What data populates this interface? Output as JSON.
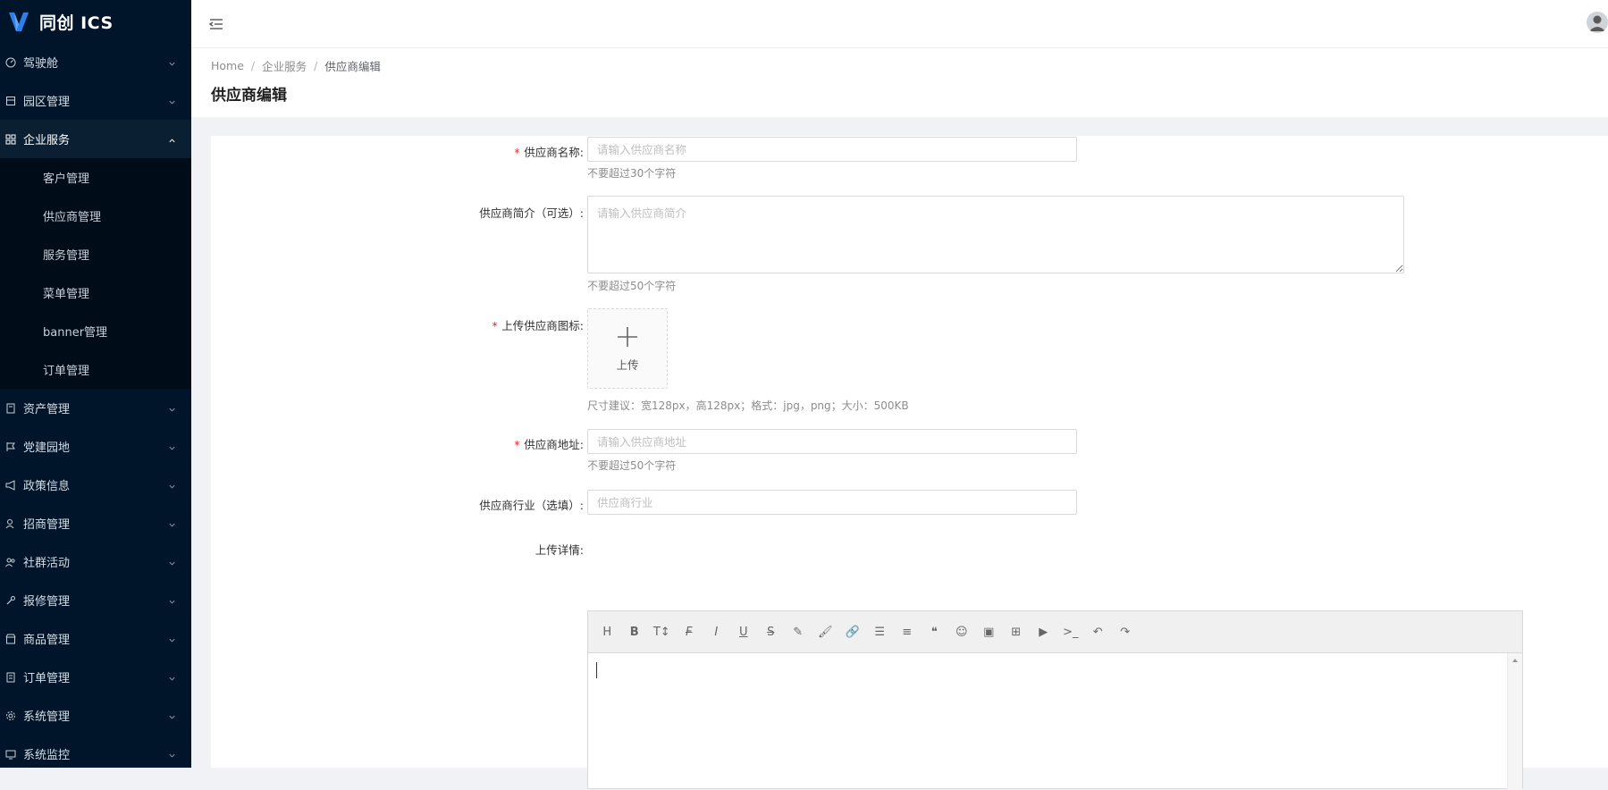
{
  "app": {
    "name": "同创 ICS"
  },
  "sidebar": {
    "items": [
      {
        "label": "驾驶舱",
        "icon": "dashboard-icon",
        "open": false
      },
      {
        "label": "园区管理",
        "icon": "building-icon",
        "open": false
      },
      {
        "label": "企业服务",
        "icon": "apps-icon",
        "open": true,
        "children": [
          {
            "label": "客户管理"
          },
          {
            "label": "供应商管理"
          },
          {
            "label": "服务管理"
          },
          {
            "label": "菜单管理"
          },
          {
            "label": "banner管理"
          },
          {
            "label": "订单管理"
          }
        ]
      },
      {
        "label": "资产管理",
        "icon": "asset-icon",
        "open": false
      },
      {
        "label": "党建园地",
        "icon": "flag-icon",
        "open": false
      },
      {
        "label": "政策信息",
        "icon": "megaphone-icon",
        "open": false
      },
      {
        "label": "招商管理",
        "icon": "user-search-icon",
        "open": false
      },
      {
        "label": "社群活动",
        "icon": "users-icon",
        "open": false
      },
      {
        "label": "报修管理",
        "icon": "wrench-icon",
        "open": false
      },
      {
        "label": "商品管理",
        "icon": "shop-icon",
        "open": false
      },
      {
        "label": "订单管理",
        "icon": "order-icon",
        "open": false
      },
      {
        "label": "系统管理",
        "icon": "gear-icon",
        "open": false
      },
      {
        "label": "系统监控",
        "icon": "monitor-icon",
        "open": false
      }
    ]
  },
  "breadcrumb": {
    "home": "Home",
    "level1": "企业服务",
    "current": "供应商编辑",
    "separator": "/"
  },
  "page": {
    "title": "供应商编辑"
  },
  "form": {
    "name": {
      "label": "供应商名称:",
      "placeholder": "请输入供应商名称",
      "hint": "不要超过30个字符",
      "required": true
    },
    "intro": {
      "label": "供应商简介（可选）:",
      "placeholder": "请输入供应商简介",
      "hint": "不要超过50个字符"
    },
    "logo": {
      "label": "上传供应商图标:",
      "button_text": "上传",
      "hint": "尺寸建议：宽128px，高128px；格式：jpg，png；大小：500KB",
      "required": true
    },
    "address": {
      "label": "供应商地址:",
      "placeholder": "请输入供应商地址",
      "hint": "不要超过50个字符",
      "required": true
    },
    "industry": {
      "label": "供应商行业（选填）:",
      "placeholder": "供应商行业"
    },
    "detail": {
      "label": "上传详情:"
    }
  },
  "editor": {
    "toolbar": [
      {
        "name": "heading-icon",
        "glyph": "H"
      },
      {
        "name": "bold-icon",
        "glyph": "B"
      },
      {
        "name": "font-size-icon",
        "glyph": "T↕"
      },
      {
        "name": "font-family-icon",
        "glyph": "F"
      },
      {
        "name": "italic-icon",
        "glyph": "I"
      },
      {
        "name": "underline-icon",
        "glyph": "U"
      },
      {
        "name": "strikethrough-icon",
        "glyph": "S"
      },
      {
        "name": "highlight-icon",
        "glyph": "✎"
      },
      {
        "name": "brush-icon",
        "glyph": "🖌"
      },
      {
        "name": "link-icon",
        "glyph": "🔗"
      },
      {
        "name": "bulleted-list-icon",
        "glyph": "☰"
      },
      {
        "name": "align-icon",
        "glyph": "≡"
      },
      {
        "name": "quote-icon",
        "glyph": "❝"
      },
      {
        "name": "emoji-icon",
        "glyph": "☺"
      },
      {
        "name": "image-icon",
        "glyph": "▣"
      },
      {
        "name": "table-icon",
        "glyph": "⊞"
      },
      {
        "name": "video-icon",
        "glyph": "▶"
      },
      {
        "name": "code-icon",
        "glyph": ">_"
      },
      {
        "name": "undo-icon",
        "glyph": "↶"
      },
      {
        "name": "redo-icon",
        "glyph": "↷"
      }
    ]
  },
  "colors": {
    "sidebar_bg": "#001529",
    "submenu_bg": "#000c17",
    "accent": "#1890ff",
    "required": "#f5222d"
  }
}
